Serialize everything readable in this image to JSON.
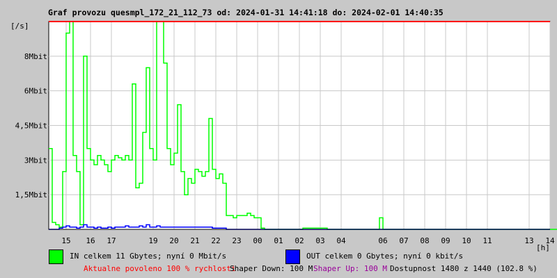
{
  "chart_data": {
    "type": "line",
    "title": "Graf provozu quesmpl_172_21_112_73 od: 2024-01-31 14:41:18 do: 2024-02-01 14:40:35",
    "ylabel": "[/s]",
    "xlabel": "[h]",
    "ylim": [
      0,
      9
    ],
    "yunit": "Mbit/s",
    "y_ticks": [
      {
        "value": 1.5,
        "label": "1,5Mbit"
      },
      {
        "value": 3,
        "label": "3Mbit"
      },
      {
        "value": 4.5,
        "label": "4,5Mbit"
      },
      {
        "value": 6,
        "label": "6Mbit"
      },
      {
        "value": 7.5,
        "label": "8Mbit"
      }
    ],
    "x_start": "14:41",
    "x_step_minutes": 10,
    "x_range_hours": [
      0,
      24
    ],
    "x_ticks": [
      "15",
      "16",
      "17",
      "19",
      "20",
      "21",
      "22",
      "23",
      "00",
      "01",
      "02",
      "03",
      "04",
      "06",
      "07",
      "08",
      "09",
      "10",
      "11",
      "13",
      "14"
    ],
    "grid": true,
    "max_line_color": "#ff0000",
    "series": [
      {
        "name": "IN",
        "color": "#00ff00",
        "values": [
          3.5,
          0.3,
          0.2,
          0.1,
          2.5,
          8.5,
          9.0,
          3.2,
          2.5,
          0.2,
          7.5,
          3.5,
          3.0,
          2.8,
          3.2,
          3.0,
          2.8,
          2.5,
          3.0,
          3.2,
          3.1,
          3.0,
          3.2,
          3.0,
          6.3,
          1.8,
          2.0,
          4.2,
          7.0,
          3.5,
          3.0,
          9.0,
          9.0,
          7.2,
          3.5,
          2.8,
          3.3,
          5.4,
          2.5,
          1.5,
          2.2,
          2.0,
          2.6,
          2.5,
          2.3,
          2.5,
          4.8,
          2.6,
          2.2,
          2.4,
          2.0,
          0.6,
          0.6,
          0.5,
          0.6,
          0.6,
          0.6,
          0.7,
          0.6,
          0.5,
          0.5,
          0.05,
          0,
          0,
          0,
          0,
          0,
          0,
          0,
          0,
          0,
          0,
          0,
          0.05,
          0.05,
          0.05,
          0.05,
          0.05,
          0.05,
          0.05,
          0,
          0,
          0,
          0,
          0,
          0,
          0,
          0,
          0,
          0,
          0,
          0,
          0,
          0,
          0,
          0.5,
          0,
          0,
          0,
          0,
          0,
          0,
          0,
          0,
          0,
          0,
          0,
          0,
          0,
          0,
          0,
          0,
          0,
          0,
          0,
          0,
          0,
          0,
          0,
          0,
          0,
          0,
          0,
          0,
          0,
          0,
          0,
          0,
          0,
          0,
          0,
          0,
          0,
          0,
          0,
          0,
          0,
          0,
          0,
          0,
          0,
          0,
          0,
          0,
          0,
          0,
          0,
          0.3,
          0
        ]
      },
      {
        "name": "OUT",
        "color": "#0000ff",
        "values": [
          0,
          0,
          0,
          0.05,
          0.1,
          0.15,
          0.1,
          0.1,
          0.05,
          0.1,
          0.2,
          0.1,
          0.1,
          0.05,
          0.1,
          0.05,
          0.05,
          0.1,
          0.05,
          0.1,
          0.1,
          0.1,
          0.15,
          0.1,
          0.1,
          0.1,
          0.15,
          0.1,
          0.2,
          0.1,
          0.1,
          0.15,
          0.1,
          0.1,
          0.1,
          0.1,
          0.1,
          0.1,
          0.1,
          0.1,
          0.1,
          0.1,
          0.1,
          0.1,
          0.1,
          0.1,
          0.1,
          0.05,
          0.05,
          0.05,
          0.05
        ]
      }
    ]
  },
  "legend": {
    "in": "IN celkem 11 Gbytes; nyní 0 Mbit/s",
    "out": "OUT celkem 0 Gbytes; nyní 0 kbit/s"
  },
  "footer": {
    "allowed": "Aktualne povoleno 100 % rychlosti",
    "shaper_down": "Shaper Down: 100 M",
    "shaper_up": "Shaper Up: 100 M",
    "availability": "Dostupnost 1480 z 1440 (102.8 %)"
  }
}
